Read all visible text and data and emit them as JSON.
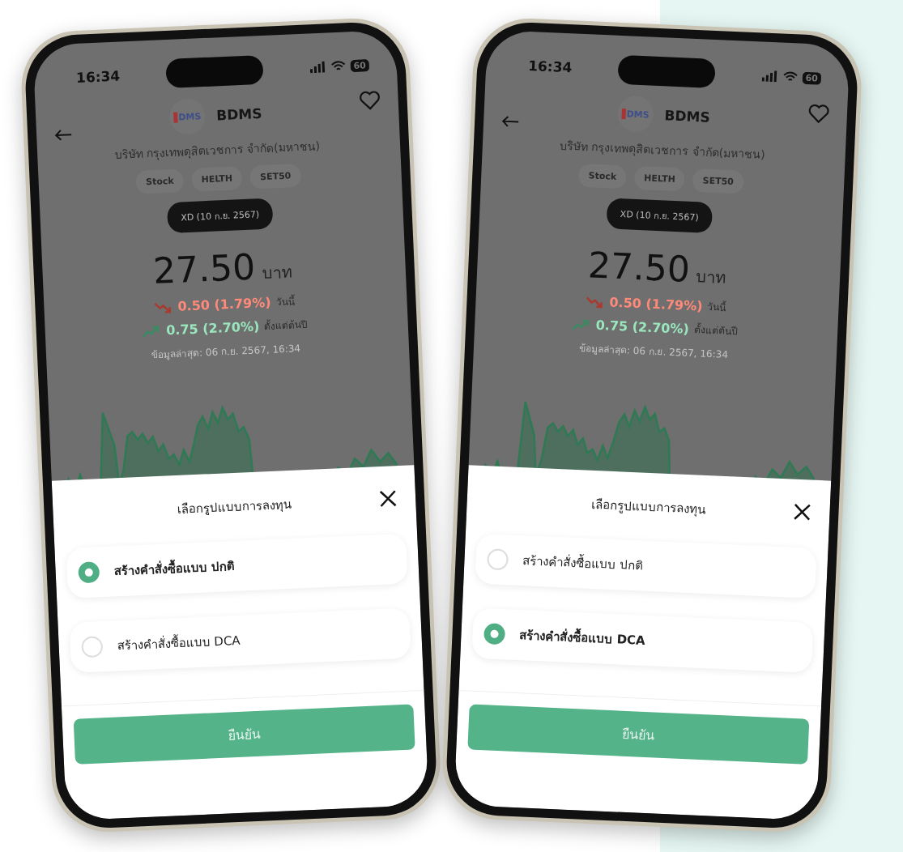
{
  "phones": [
    {
      "status_bar": {
        "time": "16:34",
        "battery": "60"
      },
      "stock": {
        "logo_text": "DMS",
        "symbol": "BDMS",
        "company_name": "บริษัท กรุงเทพดุสิตเวชการ จำกัด(มหาชน)",
        "tags": [
          "Stock",
          "HELTH",
          "SET50"
        ],
        "xd_badge": "XD (10 ก.ย. 2567)",
        "price": "27.50",
        "currency": "บาท",
        "changes": [
          {
            "kind": "down",
            "value": "0.50 (1.79%)",
            "period": "วันนี้"
          },
          {
            "kind": "up",
            "value": "0.75 (2.70%)",
            "period": "ตั้งแต่ต้นปี"
          }
        ],
        "updated": "ข้อมูลล่าสุด: 06 ก.ย. 2567, 16:34"
      },
      "sheet": {
        "title": "เลือกรูปแบบการลงทุน",
        "options": [
          {
            "label": "สร้างคำสั่งซื้อแบบ ปกติ",
            "selected": true
          },
          {
            "label": "สร้างคำสั่งซื้อแบบ DCA",
            "selected": false
          }
        ],
        "confirm": "ยืนยัน"
      }
    },
    {
      "status_bar": {
        "time": "16:34",
        "battery": "60"
      },
      "stock": {
        "logo_text": "DMS",
        "symbol": "BDMS",
        "company_name": "บริษัท กรุงเทพดุสิตเวชการ จำกัด(มหาชน)",
        "tags": [
          "Stock",
          "HELTH",
          "SET50"
        ],
        "xd_badge": "XD (10 ก.ย. 2567)",
        "price": "27.50",
        "currency": "บาท",
        "changes": [
          {
            "kind": "down",
            "value": "0.50 (1.79%)",
            "period": "วันนี้"
          },
          {
            "kind": "up",
            "value": "0.75 (2.70%)",
            "period": "ตั้งแต่ต้นปี"
          }
        ],
        "updated": "ข้อมูลล่าสุด: 06 ก.ย. 2567, 16:34"
      },
      "sheet": {
        "title": "เลือกรูปแบบการลงทุน",
        "options": [
          {
            "label": "สร้างคำสั่งซื้อแบบ ปกติ",
            "selected": false
          },
          {
            "label": "สร้างคำสั่งซื้อแบบ DCA",
            "selected": true
          }
        ],
        "confirm": "ยืนยัน"
      }
    }
  ]
}
